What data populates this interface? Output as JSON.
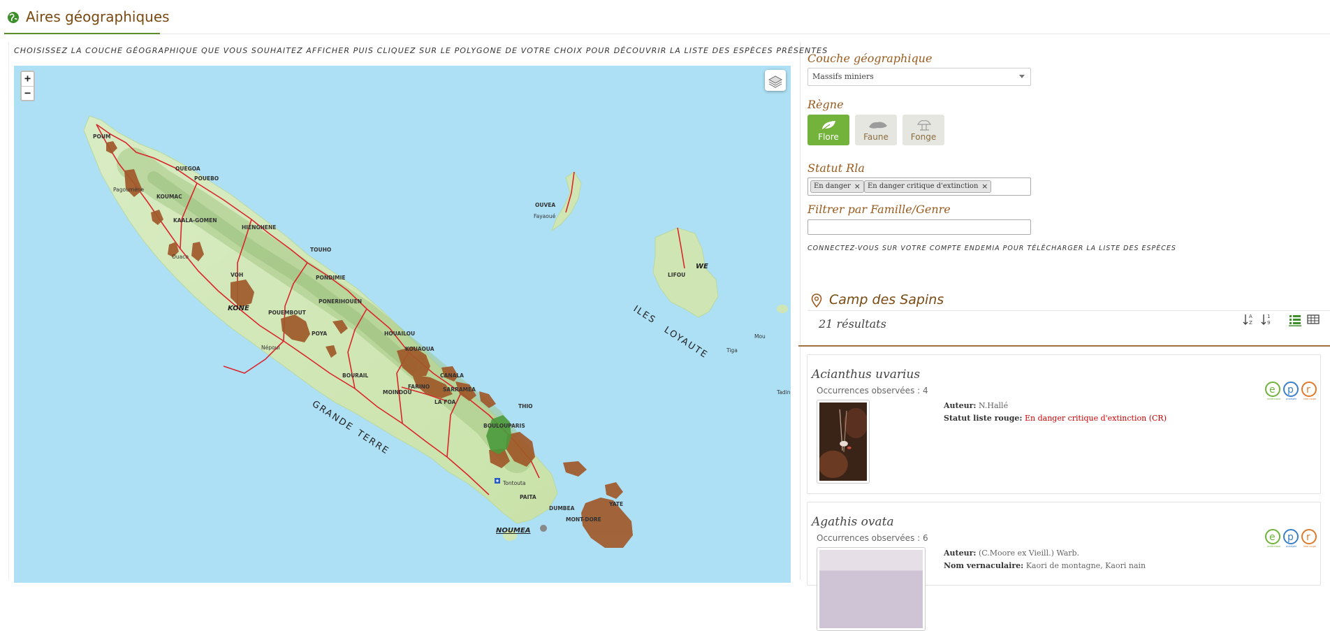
{
  "header": {
    "title": "Aires géographiques"
  },
  "instruction": "CHOISISSEZ LA COUCHE GÉOGRAPHIQUE QUE VOUS SOUHAITEZ AFFICHER PUIS CLIQUEZ SUR LE POLYGONE DE VOTRE CHOIX POUR DÉCOUVRIR LA LISTE DES ESPÈCES PRÉSENTES",
  "map": {
    "zoom_in": "+",
    "zoom_out": "−",
    "labels": {
      "poum": "POUM",
      "ouegoa": "OUEGOA",
      "pouebo": "POUEBO",
      "koumac": "KOUMAC",
      "kaala": "KAALA-GOMEN",
      "hienghene": "HIENGHENE",
      "touho": "TOUHO",
      "voh": "VOH",
      "poindimie": "PONDIMIE",
      "ponerihouen": "PONERIHOUEN",
      "kone": "KONE",
      "pouembout": "POUEMBOUT",
      "poya": "POYA",
      "houailou": "HOUAILOU",
      "kouaoua": "KOUAOUA",
      "canala": "CANALA",
      "bourail": "BOURAIL",
      "farino": "FARINO",
      "sarramea": "SARRAMEA",
      "moindou": "MOINDOU",
      "lafoa": "LA FOA",
      "thio": "THIO",
      "boulouparis": "BOULOUPARIS",
      "paita": "PAITA",
      "dumbea": "DUMBEA",
      "montdore": "MONT-DORE",
      "yate": "YATE",
      "noumea": "NOUMEA",
      "ouvea": "OUVEA",
      "fayaoue": "Fayaoué",
      "lifou": "LIFOU",
      "we": "WE",
      "iles": "ILES",
      "loyaute": "LOYAUTE",
      "grande": "GRANDE",
      "terre": "TERRE",
      "nepoui": "Népoui",
      "ouaco": "Ouaco",
      "pagou": "Pagoumène",
      "tontouta": "Tontouta",
      "tadine": "Tadine",
      "tiga": "Tiga",
      "mou": "Mou"
    }
  },
  "form": {
    "couche_label": "Couche géographique",
    "couche_value": "Massifs miniers",
    "regne_label": "Règne",
    "regne_buttons": [
      {
        "label": "Flore",
        "active": true
      },
      {
        "label": "Faune",
        "active": false
      },
      {
        "label": "Fonge",
        "active": false
      }
    ],
    "statut_label": "Statut Rla",
    "statut_tags": [
      "En danger",
      "En danger critique d'extinction"
    ],
    "tag_remove": "×",
    "filtre_label": "Filtrer par Famille/Genre",
    "connect_note": "CONNECTEZ-VOUS SUR VOTRE COMPTE ENDEMIA POUR TÉLÉCHARGER LA LISTE DES ESPÈCES"
  },
  "results": {
    "location": "Camp des Sapins",
    "count": "21 résultats",
    "species": [
      {
        "name": "Acianthus uvarius",
        "occurrences": "Occurrences observées : 4",
        "auteur_label": "Auteur:",
        "auteur": "N.Hallé",
        "statut_label": "Statut liste rouge:",
        "statut": "En danger critique d'extinction (CR)"
      },
      {
        "name": "Agathis ovata",
        "occurrences": "Occurrences observées : 6",
        "auteur_label": "Auteur:",
        "auteur": "(C.Moore ex Vieill.) Warb.",
        "vern_label": "Nom vernaculaire:",
        "vern": "Kaori de montagne, Kaori nain"
      }
    ],
    "badges": {
      "e": "e",
      "p": "p",
      "r": "r",
      "e_sub": "endémique",
      "p_sub": "protégée",
      "r_sub": "liste rouge"
    }
  },
  "colors": {
    "accent_brown": "#7a4a12",
    "flore_green": "#74b33b",
    "polygon_brown": "#a0592a",
    "polygon_green": "#4a9a3c"
  }
}
